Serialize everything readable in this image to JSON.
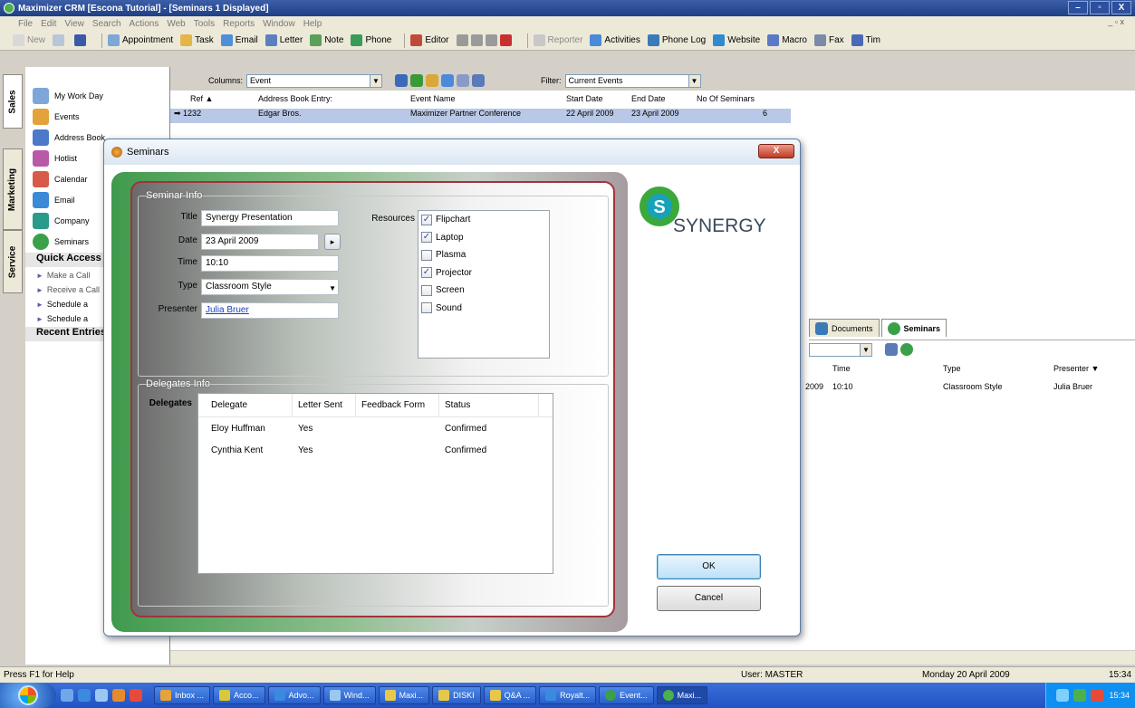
{
  "app": {
    "title": "Maximizer CRM [Escona Tutorial] - [Seminars 1 Displayed]",
    "window_buttons": [
      "–",
      "▫",
      "X"
    ],
    "mdi_buttons": "_ ▫ x"
  },
  "menu": [
    "File",
    "Edit",
    "View",
    "Search",
    "Actions",
    "Web",
    "Tools",
    "Reports",
    "Window",
    "Help"
  ],
  "toolbar": {
    "new": "New",
    "appointment": "Appointment",
    "task": "Task",
    "email": "Email",
    "letter": "Letter",
    "note": "Note",
    "phone": "Phone",
    "editor": "Editor",
    "reporter": "Reporter",
    "activities": "Activities",
    "phone_log": "Phone Log",
    "website": "Website",
    "macro": "Macro",
    "fax": "Fax",
    "tim": "Tim"
  },
  "side_tabs": [
    "Sales",
    "Marketing",
    "Service"
  ],
  "nav": {
    "items": [
      "My Work Day",
      "Events",
      "Address Book",
      "Hotlist",
      "Calendar",
      "Email",
      "Company",
      "Seminars"
    ],
    "quick_access": "Quick Access",
    "quick_items": [
      "Make a Call",
      "Receive a Call",
      "Schedule a",
      "Schedule a"
    ],
    "recent": "Recent Entries"
  },
  "grid": {
    "columns_label": "Columns:",
    "columns_value": "Event",
    "filter_label": "Filter:",
    "filter_value": "Current Events",
    "headers": [
      "Ref ▲",
      "Address Book Entry:",
      "Event Name",
      "Start Date",
      "End Date",
      "No Of Seminars"
    ],
    "row": [
      "1232",
      "Edgar Bros.",
      "Maximizer Partner Conference",
      "22 April 2009",
      "23 April 2009",
      "6"
    ]
  },
  "lower_pane": {
    "tabs": [
      "Documents",
      "Seminars"
    ],
    "headers": [
      "Time",
      "Type",
      "Presenter ▼"
    ],
    "row": [
      "2009",
      "10:10",
      "Classroom Style",
      "Julia Bruer"
    ]
  },
  "status": {
    "help": "Press F1 for Help",
    "user": "User: MASTER",
    "date": "Monday 20 April 2009",
    "time": "15:34"
  },
  "taskbar": {
    "buttons": [
      "Inbox ...",
      "Acco...",
      "Advo...",
      "Wind...",
      "Maxi...",
      "DISKI",
      "Q&A ...",
      "Royalt...",
      "Event...",
      "Maxi..."
    ],
    "clock": "15:34"
  },
  "dialog": {
    "title": "Seminars",
    "close": "X",
    "seminar_info": "Seminar Info",
    "title_label": "Title",
    "title_value": "Synergy Presentation",
    "date_label": "Date",
    "date_value": "23 April 2009",
    "time_label": "Time",
    "time_value": "10:10",
    "type_label": "Type",
    "type_value": "Classroom Style",
    "presenter_label": "Presenter",
    "presenter_value": "Julia Bruer",
    "resources_label": "Resources",
    "resources": [
      {
        "name": "Flipchart",
        "checked": true
      },
      {
        "name": "Laptop",
        "checked": true
      },
      {
        "name": "Plasma",
        "checked": false
      },
      {
        "name": "Projector",
        "checked": true
      },
      {
        "name": "Screen",
        "checked": false
      },
      {
        "name": "Sound",
        "checked": false
      }
    ],
    "delegates_info": "Delegates Info",
    "delegates_label": "Delegates",
    "delegate_headers": [
      "Delegate",
      "Letter Sent",
      "Feedback Form",
      "Status"
    ],
    "delegates": [
      [
        "Eloy Huffman",
        "Yes",
        "",
        "Confirmed"
      ],
      [
        "Cynthia Kent",
        "Yes",
        "",
        "Confirmed"
      ]
    ],
    "logo_letter": "S",
    "logo_text": "SYNERGY",
    "ok": "OK",
    "cancel": "Cancel"
  }
}
